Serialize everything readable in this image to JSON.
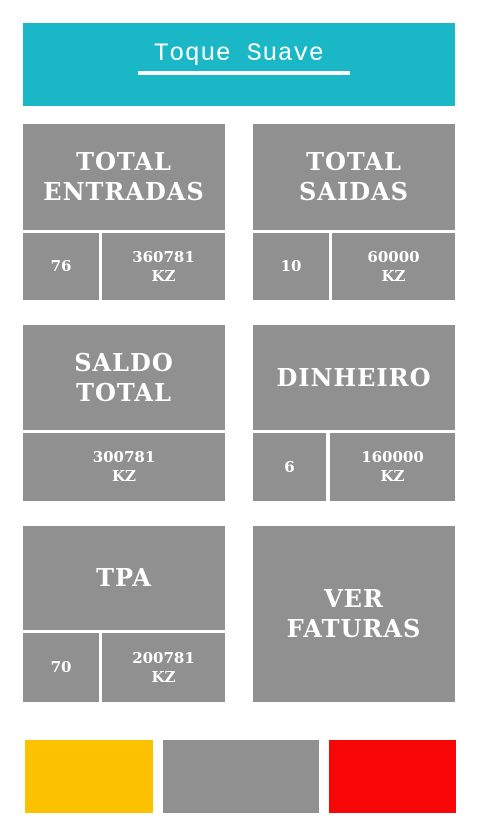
{
  "header": {
    "title": "Toque Suave"
  },
  "cards": {
    "total_entradas": {
      "title_line1": "TOTAL",
      "title_line2": "ENTRADAS",
      "count": "76",
      "amount": "360781",
      "currency": "KZ"
    },
    "total_saidas": {
      "title_line1": "TOTAL",
      "title_line2": "SAIDAS",
      "count": "10",
      "amount": "60000",
      "currency": "KZ"
    },
    "saldo_total": {
      "title_line1": "SALDO",
      "title_line2": "TOTAL",
      "amount": "300781",
      "currency": "KZ"
    },
    "dinheiro": {
      "title": "DINHEIRO",
      "count": "6",
      "amount": "160000",
      "currency": "KZ"
    },
    "tpa": {
      "title": "TPA",
      "count": "70",
      "amount": "200781",
      "currency": "KZ"
    },
    "ver_faturas": {
      "title_line1": "VER",
      "title_line2": "FATURAS"
    }
  },
  "bottom_buttons": {
    "colors": [
      "#fcc200",
      "#909090",
      "#f80505"
    ]
  }
}
